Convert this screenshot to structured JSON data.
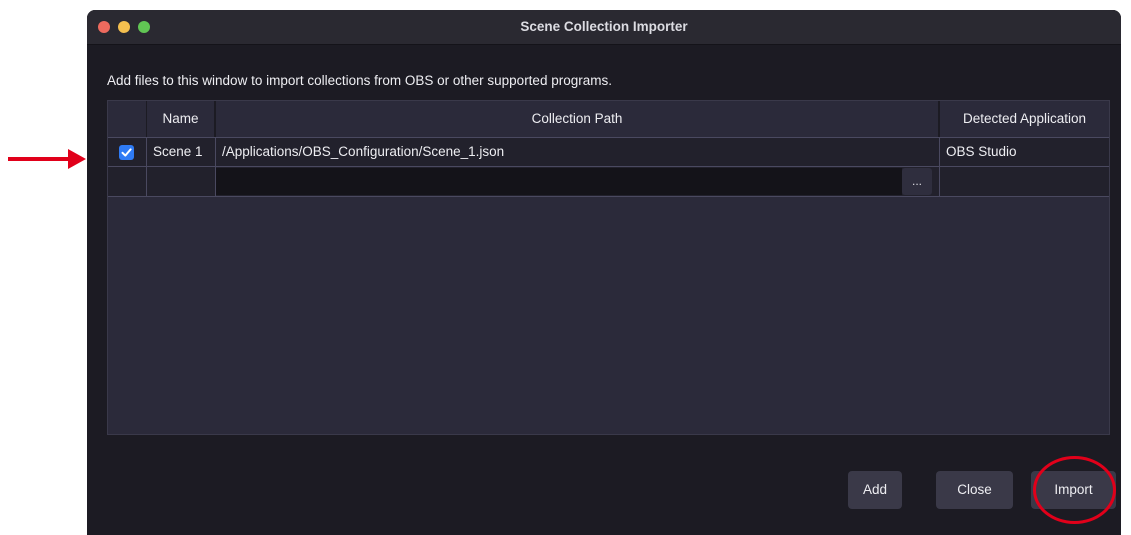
{
  "window": {
    "title": "Scene Collection Importer"
  },
  "description": "Add files to this window to import collections from OBS or other supported programs.",
  "table": {
    "headers": {
      "name": "Name",
      "path": "Collection Path",
      "app": "Detected Application"
    },
    "rows": [
      {
        "checked": true,
        "name": "Scene 1",
        "path": "/Applications/OBS_Configuration/Scene_1.json",
        "app": "OBS Studio"
      }
    ],
    "new_row": {
      "path_value": "",
      "browse_label": "..."
    }
  },
  "buttons": {
    "add": "Add",
    "close": "Close",
    "import": "Import"
  },
  "colors": {
    "annotation": "#e1001a",
    "checkbox": "#2f7bf5",
    "window_bg": "#1c1b23"
  },
  "icons": {
    "checkbox": "checkmark-icon",
    "annotation_arrow": "arrow-right-icon"
  }
}
